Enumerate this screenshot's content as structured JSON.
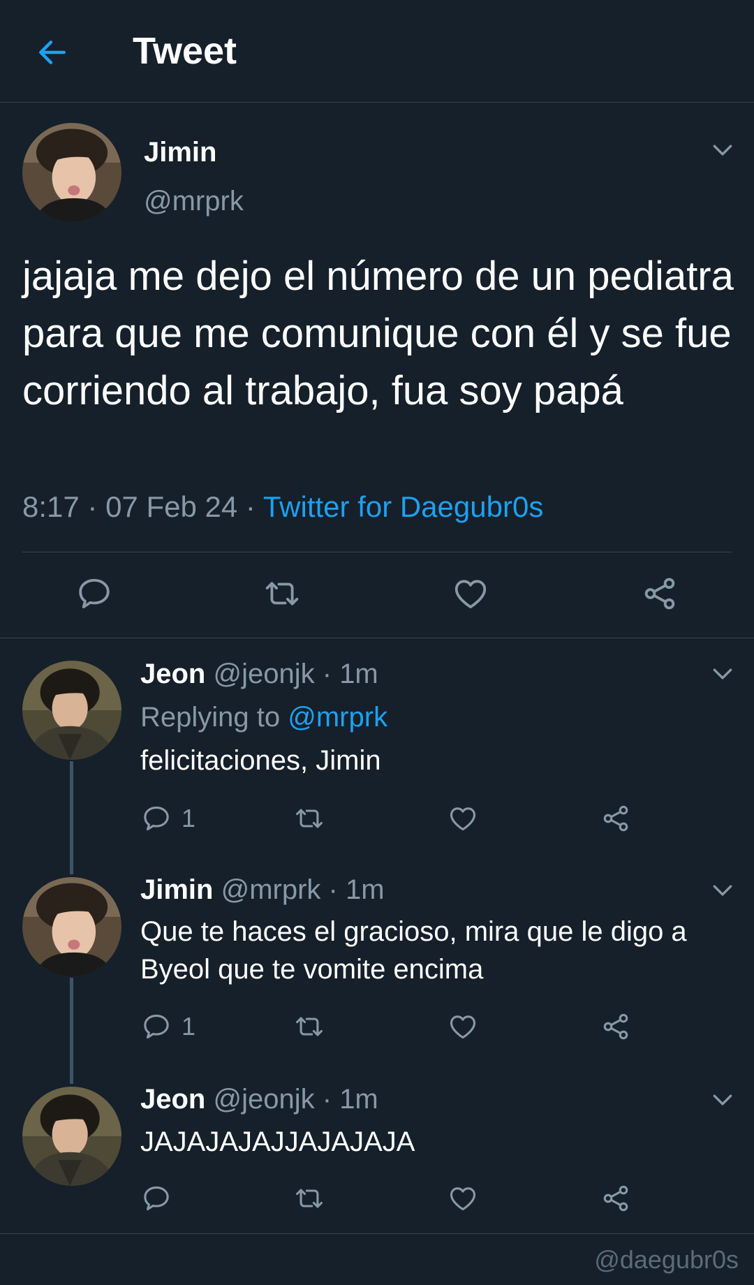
{
  "header": {
    "title": "Tweet",
    "back_icon": "arrow-left-icon"
  },
  "colors": {
    "background": "#15202b",
    "accent": "#1da1f2",
    "muted": "#8899a6",
    "divider": "#38444d"
  },
  "main_tweet": {
    "name": "Jimin",
    "handle": "@mrprk",
    "text": "jajaja me dejo el número de un pediatra para que me comunique con él y se fue corriendo al trabajo, fua soy papá",
    "time": "8:17",
    "date": "07 Feb 24",
    "source": "Twitter for Daegubr0s"
  },
  "replies": [
    {
      "name": "Jeon",
      "handle": "@jeonjk",
      "time": "1m",
      "replying_label": "Replying to",
      "replying_to": "@mrprk",
      "text": "felicitaciones, Jimin",
      "reply_count": "1"
    },
    {
      "name": "Jimin",
      "handle": "@mrprk",
      "time": "1m",
      "text": "Que te haces el gracioso, mira que le digo a Byeol que te vomite encima",
      "reply_count": "1"
    },
    {
      "name": "Jeon",
      "handle": "@jeonjk",
      "time": "1m",
      "text": "JAJAJAJAJJAJAJAJA",
      "reply_count": ""
    }
  ],
  "watermark": "@daegubr0s"
}
